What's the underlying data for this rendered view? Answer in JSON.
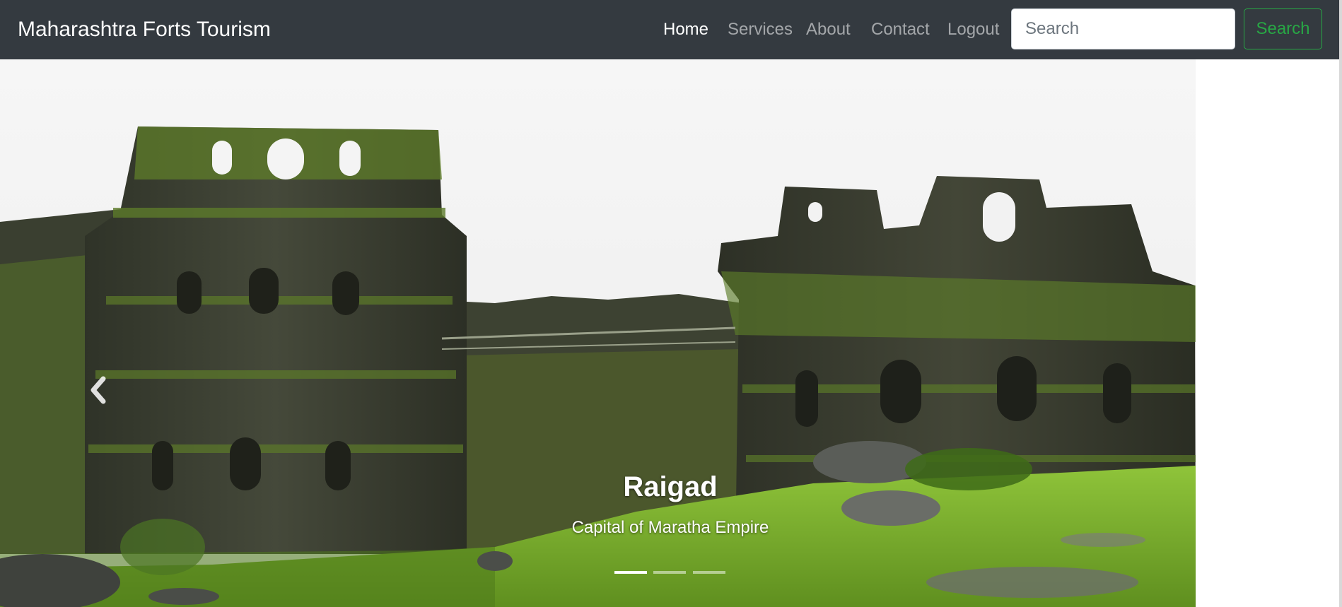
{
  "navbar": {
    "brand": "Maharashtra Forts Tourism",
    "links": [
      {
        "label": "Home",
        "active": true
      },
      {
        "label": "Services",
        "active": false
      },
      {
        "label": "About",
        "active": false
      },
      {
        "label": "Contact",
        "active": false
      },
      {
        "label": "Logout",
        "active": false
      }
    ],
    "search": {
      "placeholder": "Search",
      "value": ""
    },
    "search_button": "Search"
  },
  "carousel": {
    "slides_count": 3,
    "active_slide": 1,
    "caption": {
      "title": "Raigad",
      "subtitle": "Capital of Maratha Empire"
    },
    "controls": {
      "prev_icon": "chevron-left-icon"
    }
  },
  "colors": {
    "navbar_bg": "#343a40",
    "success": "#28a745",
    "moss": "#6e9b2a",
    "stone": "#3b3d35"
  }
}
